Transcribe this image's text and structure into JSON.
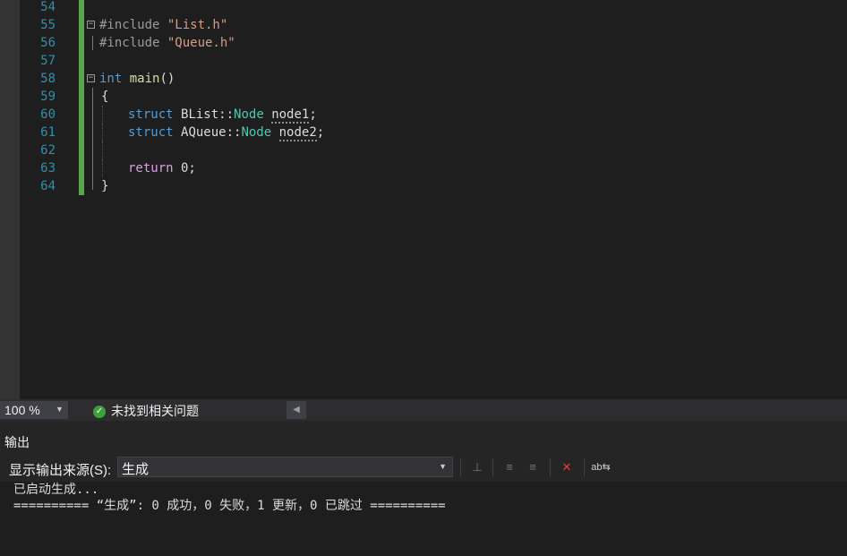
{
  "editor": {
    "lines": [
      {
        "num": "54"
      },
      {
        "num": "55",
        "pre": "#include ",
        "str": "\"List.h\""
      },
      {
        "num": "56",
        "pre": "#include ",
        "str": "\"Queue.h\""
      },
      {
        "num": "57"
      },
      {
        "num": "58",
        "kw": "int",
        "fn": "main",
        "rest": "()"
      },
      {
        "num": "59",
        "brace": "{"
      },
      {
        "num": "60",
        "kw": "struct",
        "cls": "BList",
        "sep": "::",
        "type": "Node",
        "var": "node1",
        "end": ";"
      },
      {
        "num": "61",
        "kw": "struct",
        "cls": "AQueue",
        "sep": "::",
        "type": "Node",
        "var": "node2",
        "end": ";"
      },
      {
        "num": "62"
      },
      {
        "num": "63",
        "kw": "return",
        "rest": " 0;"
      },
      {
        "num": "64",
        "brace": "}"
      }
    ],
    "colors": {
      "line_number": "#2b91af",
      "change_bar": "#57a64a",
      "keyword": "#569cd6",
      "string": "#d69d85",
      "type": "#4ec9b0"
    }
  },
  "statusbar": {
    "zoom": "100 %",
    "issues_icon": "check-circle-icon",
    "issues_text": "未找到相关问题"
  },
  "output": {
    "title": "输出",
    "source_label": "显示输出来源(S):",
    "source_value": "生成",
    "lines": [
      "已启动生成...",
      "========== “生成”: 0 成功，0 失败，1 更新，0 已跳过 =========="
    ]
  }
}
